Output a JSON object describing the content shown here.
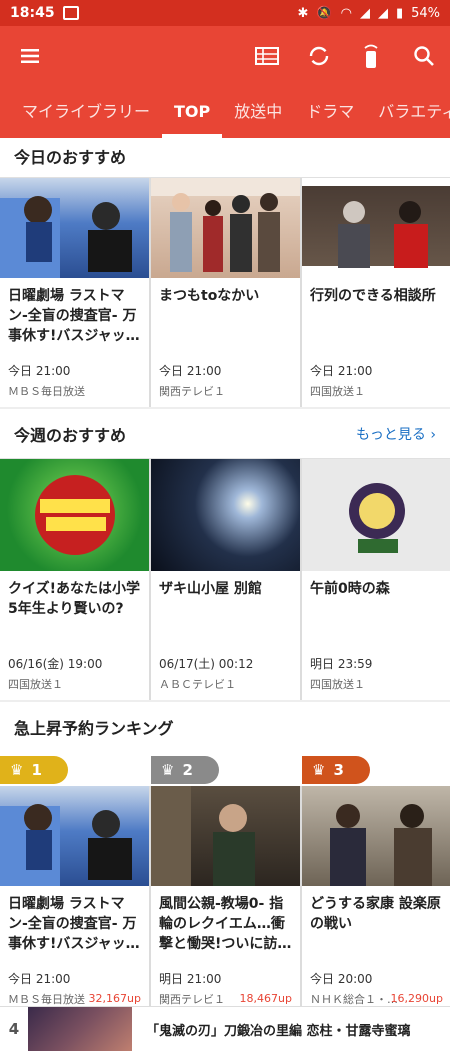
{
  "status": {
    "time": "18:45",
    "battery": "54%"
  },
  "tabs": [
    "マイライブラリー",
    "TOP",
    "放送中",
    "ドラマ",
    "バラエティ"
  ],
  "sections": {
    "today": {
      "title": "今日のおすすめ"
    },
    "week": {
      "title": "今週のおすすめ",
      "more": "もっと見る ›"
    },
    "ranking": {
      "title": "急上昇予約ランキング"
    }
  },
  "today_cards": [
    {
      "title": "日曜劇場 ラストマン-全盲の捜査官- 万事休す!バスジャッ…",
      "time": "今日 21:00",
      "channel": "ＭＢＳ毎日放送"
    },
    {
      "title": "まつもtoなかい",
      "time": "今日 21:00",
      "channel": "関西テレビ１"
    },
    {
      "title": "行列のできる相談所",
      "time": "今日 21:00",
      "channel": "四国放送１"
    }
  ],
  "week_cards": [
    {
      "title": "クイズ!あなたは小学5年生より賢いの?",
      "time": "06/16(金) 19:00",
      "channel": "四国放送１"
    },
    {
      "title": "ザキ山小屋 別館",
      "time": "06/17(土) 00:12",
      "channel": "ＡＢＣテレビ１"
    },
    {
      "title": "午前0時の森",
      "time": "明日 23:59",
      "channel": "四国放送１"
    }
  ],
  "ranking_cards": [
    {
      "rank": "1",
      "title": "日曜劇場 ラストマン-全盲の捜査官- 万事休す!バスジャッ…",
      "time": "今日 21:00",
      "channel": "ＭＢＳ毎日放送",
      "up": "32,167up"
    },
    {
      "rank": "2",
      "title": "風間公親-教場0- 指輪のレクイエム…衝撃と慟哭!ついに訪…",
      "time": "明日 21:00",
      "channel": "関西テレビ１",
      "up": "18,467up"
    },
    {
      "rank": "3",
      "title": "どうする家康 設楽原の戦い",
      "time": "今日 20:00",
      "channel": "ＮＨＫ総合１・…",
      "up": "16,290up"
    }
  ],
  "bottom_item": {
    "rank": "4",
    "title": "「鬼滅の刃」刀鍛冶の里編 恋柱・甘露寺蜜璃"
  },
  "colors": {
    "appbar": "#e84535",
    "gold": "#e0b21a",
    "silver": "#8a8a8a",
    "bronze": "#d0531c"
  },
  "icons": [
    "menu-icon",
    "list-icon",
    "refresh-icon",
    "remote-icon",
    "search-icon"
  ]
}
